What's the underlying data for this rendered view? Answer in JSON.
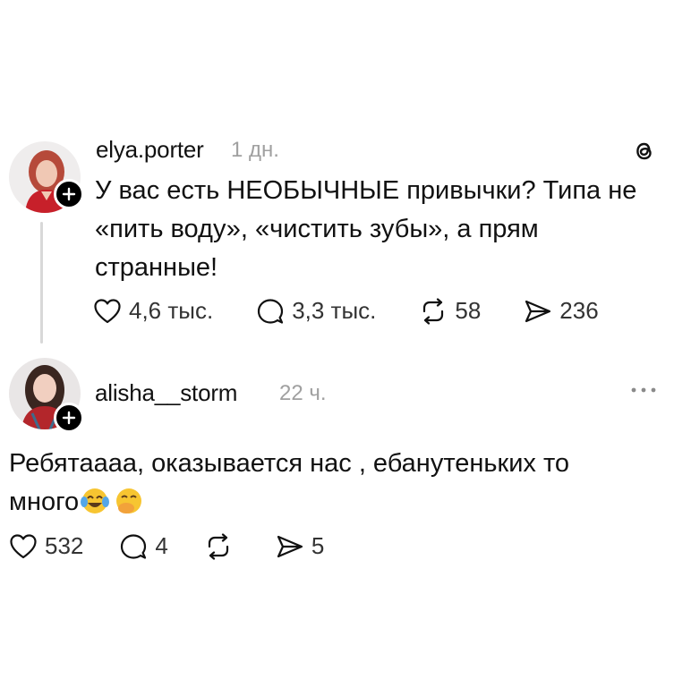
{
  "posts": [
    {
      "username": "elya.porter",
      "time": "1 дн.",
      "text": "У вас есть НЕОБЫЧНЫЕ привычки? Типа не «пить воду», «чистить зубы», а прям странные!",
      "likes": "4,6 тыс.",
      "replies": "3,3 тыс.",
      "reposts": "58",
      "shares": "236",
      "corner_icon": "threads-logo-icon"
    },
    {
      "username": "alisha__storm",
      "time": "22 ч.",
      "text": "Ребятаааа, оказывается нас , ебанутеньких то много",
      "emojis": [
        "face-with-tears-of-joy",
        "face-with-hand-over-mouth"
      ],
      "likes": "532",
      "replies": "4",
      "reposts": "",
      "shares": "5",
      "corner_icon": "more-icon"
    }
  ],
  "colors": {
    "text": "#111111",
    "muted": "#a0a0a0",
    "line": "#d8d8d8"
  }
}
